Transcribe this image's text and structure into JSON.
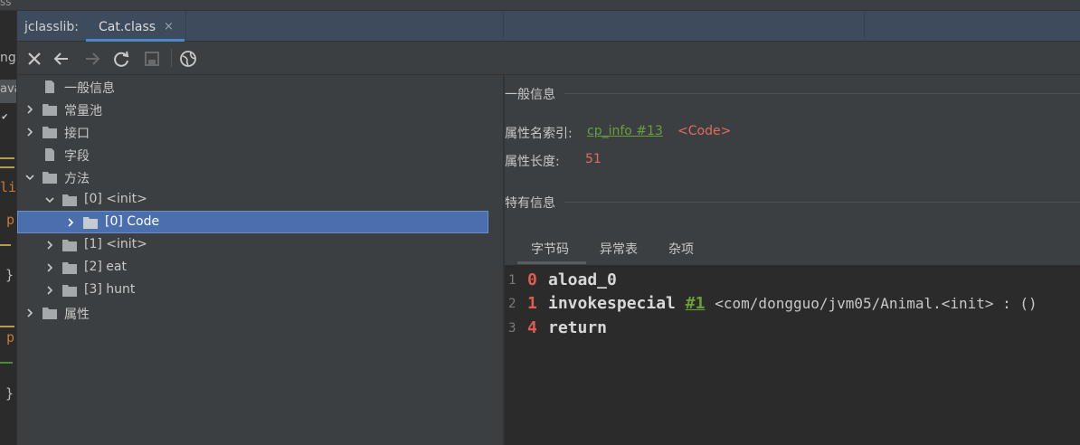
{
  "window": {
    "top_fragment": "ss"
  },
  "editor_sliver": {
    "fragments": [
      "ng",
      "ava",
      "li",
      "p",
      "}",
      "p",
      "}"
    ]
  },
  "tabbar": {
    "prefix": "jclasslib:",
    "active_tab": "Cat.class",
    "close_glyph": "×"
  },
  "toolbar": {
    "buttons": [
      {
        "name": "close",
        "icon": "close-icon",
        "glyph": "✕"
      },
      {
        "name": "back",
        "icon": "arrow-left-icon",
        "glyph": "←"
      },
      {
        "name": "forward",
        "icon": "arrow-right-icon",
        "glyph": "→"
      },
      {
        "name": "reload",
        "icon": "refresh-icon",
        "glyph": "⟳"
      },
      {
        "name": "save",
        "icon": "save-icon",
        "glyph": "▣"
      },
      {
        "name": "web",
        "icon": "globe-icon",
        "glyph": "◍"
      }
    ]
  },
  "tree": {
    "nodes": [
      {
        "label": "一般信息",
        "icon": "file-icon",
        "expandable": false
      },
      {
        "label": "常量池",
        "icon": "folder-icon",
        "expandable": true,
        "expanded": false
      },
      {
        "label": "接口",
        "icon": "folder-icon",
        "expandable": true,
        "expanded": false
      },
      {
        "label": "字段",
        "icon": "file-icon",
        "expandable": false
      },
      {
        "label": "方法",
        "icon": "folder-icon",
        "expandable": true,
        "expanded": true
      },
      {
        "label": "[0] <init>",
        "icon": "folder-icon",
        "expandable": true,
        "expanded": true
      },
      {
        "label": "[0] Code",
        "icon": "folder-icon",
        "expandable": true,
        "expanded": false,
        "selected": true
      },
      {
        "label": "[1] <init>",
        "icon": "folder-icon",
        "expandable": true,
        "expanded": false
      },
      {
        "label": "[2] eat",
        "icon": "folder-icon",
        "expandable": true,
        "expanded": false
      },
      {
        "label": "[3] hunt",
        "icon": "folder-icon",
        "expandable": true,
        "expanded": false
      },
      {
        "label": "属性",
        "icon": "folder-icon",
        "expandable": true,
        "expanded": false
      }
    ]
  },
  "detail": {
    "general_header": "一般信息",
    "attr_name_index_label": "属性名索引:",
    "attr_name_index_link": "cp_info #13",
    "attr_name_index_value": "<Code>",
    "attr_length_label": "属性长度:",
    "attr_length_value": "51",
    "specific_header": "特有信息",
    "subtabs": [
      "字节码",
      "异常表",
      "杂项"
    ],
    "active_subtab": "字节码"
  },
  "bytecode": [
    {
      "line": "1",
      "offset": "0",
      "opcode": "aload_0",
      "ref": "",
      "comment": ""
    },
    {
      "line": "2",
      "offset": "1",
      "opcode": "invokespecial",
      "ref": "#1",
      "comment": "<com/dongguo/jvm05/Animal.<init> : ()"
    },
    {
      "line": "3",
      "offset": "4",
      "opcode": "return",
      "ref": "",
      "comment": ""
    }
  ],
  "colors": {
    "selection": "#4b6eaf",
    "link_green": "#6a9f3a",
    "value_red": "#e06c5e",
    "tab_underline": "#4a88c7"
  }
}
